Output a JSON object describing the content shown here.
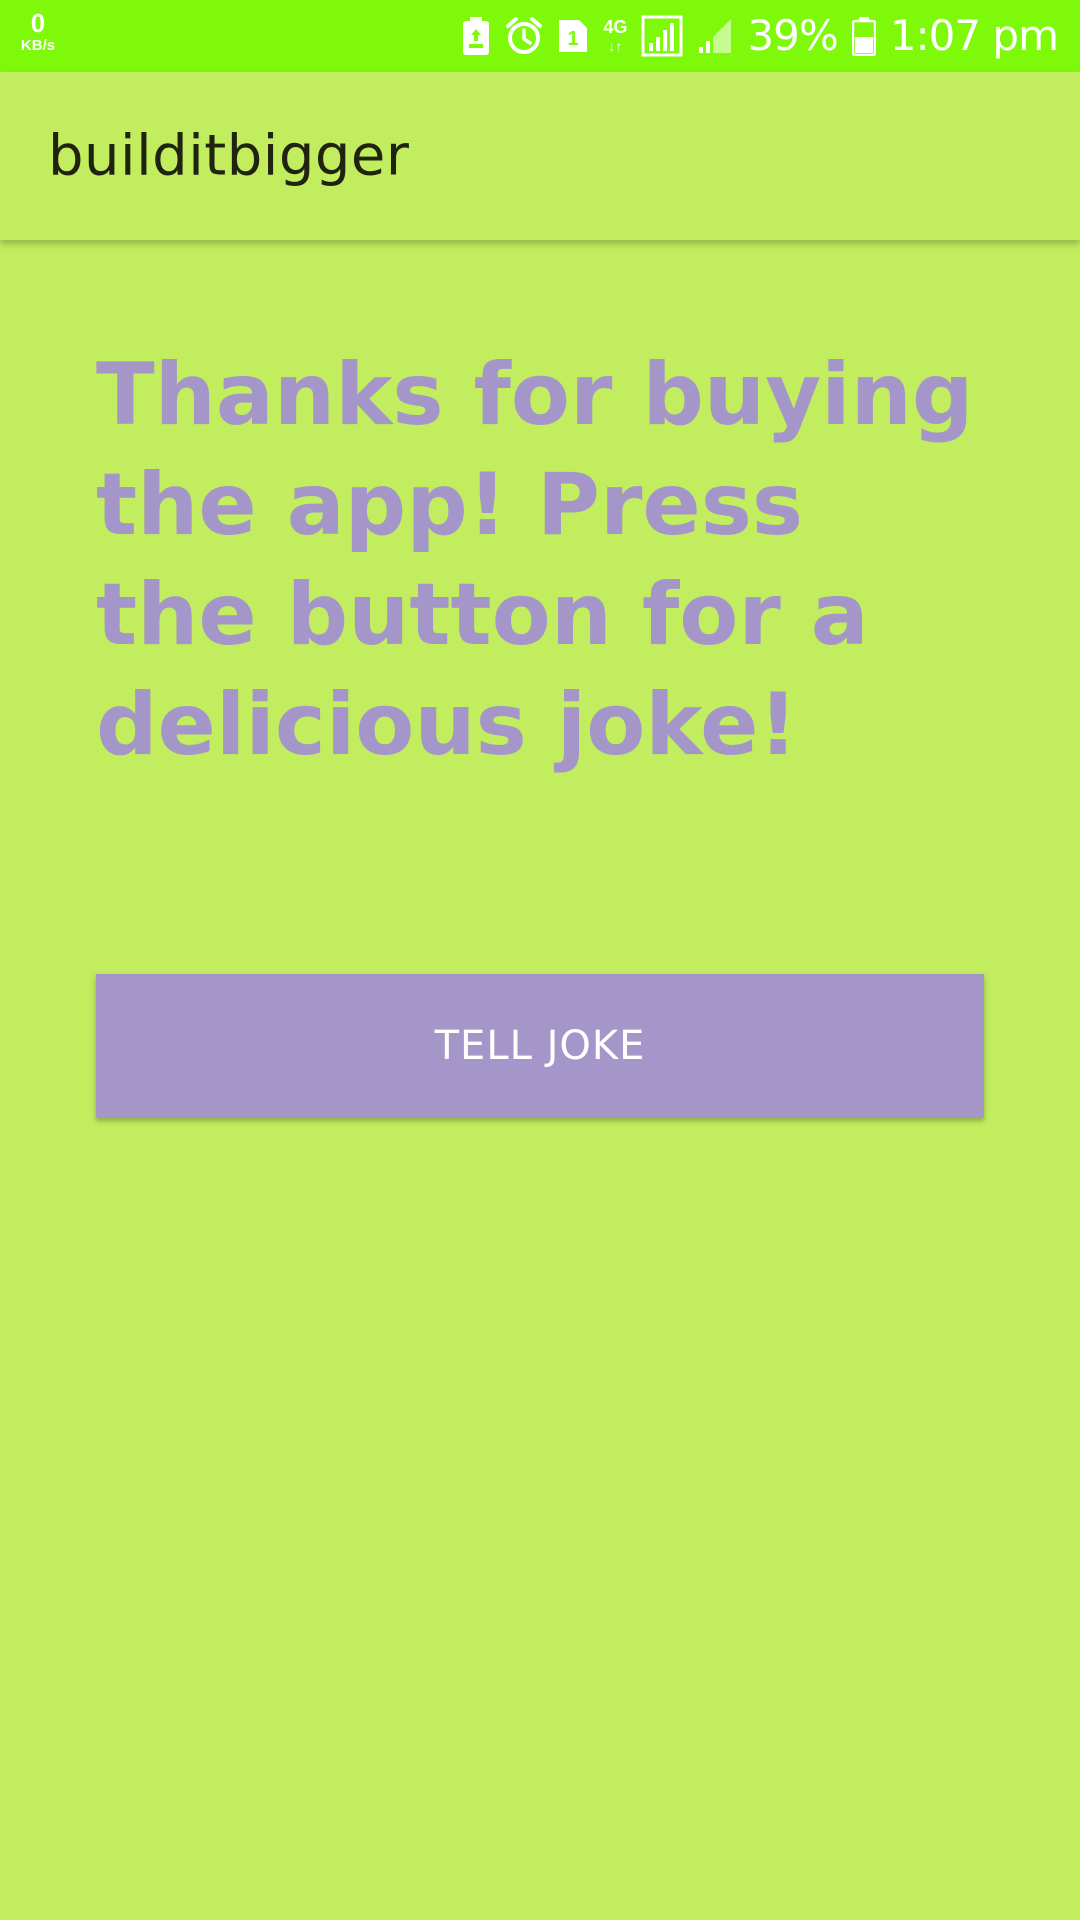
{
  "status_bar": {
    "speed_value": "0",
    "speed_unit": "KB/s",
    "network_type": "4G",
    "sim_slot": "1",
    "battery_percent": "39%",
    "time": "1:07 pm",
    "icons": [
      "battery-saver-icon",
      "alarm-icon",
      "sim-icon",
      "data-arrows-icon",
      "signal-icon",
      "signal-weak-icon",
      "battery-icon"
    ]
  },
  "app_bar": {
    "title": "builditbigger"
  },
  "main": {
    "message": "Thanks for buying the app! Press the button for a delicious joke!",
    "button_label": "TELL JOKE"
  },
  "colors": {
    "status_bar": "#7ef90a",
    "background": "#c1ed5e",
    "accent": "#a596c9",
    "title_text": "#1f2310"
  }
}
